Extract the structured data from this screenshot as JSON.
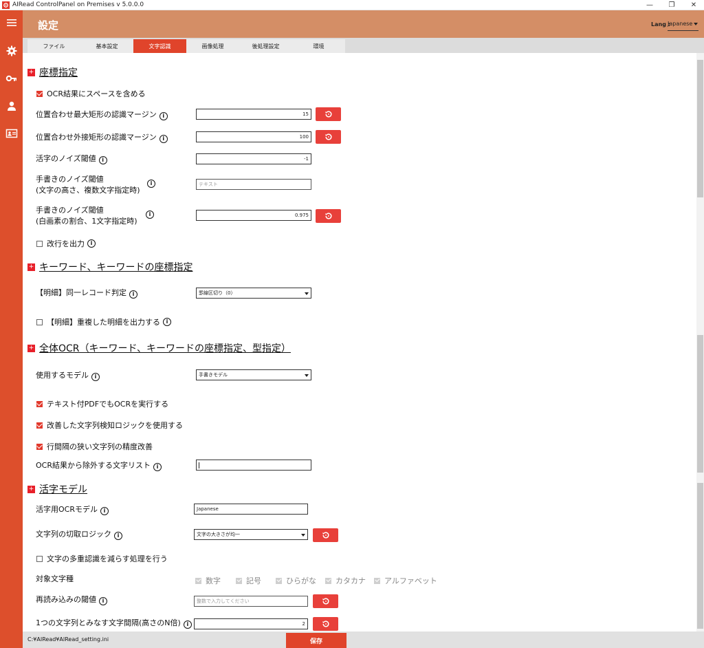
{
  "window": {
    "title": "AIRead ControlPanel on Premises v 5.0.0.0",
    "minimize": "—",
    "restore": "❐",
    "close": "✕"
  },
  "sidebar": {
    "icons": [
      "menu-icon",
      "gear-icon",
      "key-icon",
      "person-icon",
      "id-card-icon"
    ]
  },
  "header": {
    "title": "設定",
    "lang_label": "Lang :",
    "lang_value": "Japanese"
  },
  "tabs": [
    {
      "label": "ファイル"
    },
    {
      "label": "基本設定"
    },
    {
      "label": "文字認識"
    },
    {
      "label": "画像処理"
    },
    {
      "label": "後処理設定"
    },
    {
      "label": "環境"
    }
  ],
  "active_tab": "文字認識",
  "sections": {
    "coord": {
      "title": "座標指定",
      "include_space": {
        "label": "OCR結果にスペースを含める",
        "checked": true
      },
      "max_rect_margin": {
        "label": "位置合わせ最大矩形の認識マージン",
        "value": "15"
      },
      "outer_rect_margin": {
        "label": "位置合わせ外接矩形の認識マージン",
        "value": "100"
      },
      "print_noise": {
        "label": "活字のノイズ閾値",
        "value": "-1"
      },
      "hand_noise_height": {
        "label1": "手書きのノイズ閾値",
        "label2": "(文字の高さ、複数文字指定時)",
        "placeholder": "テキスト"
      },
      "hand_noise_ratio": {
        "label1": "手書きのノイズ閾値",
        "label2": "(白画素の割合、1文字指定時)",
        "value": "0.975"
      },
      "output_newline": {
        "label": "改行を出力",
        "checked": false
      }
    },
    "keyword": {
      "title": "キーワード、キーワードの座標指定",
      "same_record": {
        "label": "【明細】同一レコード判定",
        "value": "罫線区切り（0）"
      },
      "dup_detail": {
        "label": "【明細】重複した明細を出力する",
        "checked": false
      }
    },
    "full_ocr": {
      "title": "全体OCR（キーワード、キーワードの座標指定、型指定）",
      "model": {
        "label": "使用するモデル",
        "value": "手書きモデル"
      },
      "pdf_ocr": {
        "label": "テキスト付PDFでもOCRを実行する",
        "checked": true
      },
      "improved_logic": {
        "label": "改善した文字列検知ロジックを使用する",
        "checked": true
      },
      "narrow_lines": {
        "label": "行間隔の狭い文字列の精度改善",
        "checked": true
      },
      "exclude_chars": {
        "label": "OCR結果から除外する文字リスト",
        "value": ""
      }
    },
    "print_model": {
      "title": "活字モデル",
      "ocr_model": {
        "label": "活字用OCRモデル",
        "value": "Japanese"
      },
      "cut_logic": {
        "label": "文字列の切取ロジック",
        "value": "文字の大きさが均一"
      },
      "reduce_multi": {
        "label": "文字の多重認識を減らす処理を行う",
        "checked": false
      },
      "target_types": {
        "label": "対象文字種",
        "items": [
          "数字",
          "記号",
          "ひらがな",
          "カタカナ",
          "アルファベット"
        ]
      },
      "reread_threshold": {
        "label": "再読み込みの閾値",
        "placeholder": "整数で入力してください"
      },
      "char_gap": {
        "label": "1つの文字列とみなす文字間隔(高さのN倍)",
        "value": "2"
      }
    }
  },
  "info_glyph": "i",
  "footer": {
    "path": "C:¥AIRead¥AIRead_setting.ini",
    "save_label": "保存"
  },
  "colors": {
    "sidebar": "#dd4f2c",
    "header": "#d48e66",
    "accent": "#e0442b"
  }
}
